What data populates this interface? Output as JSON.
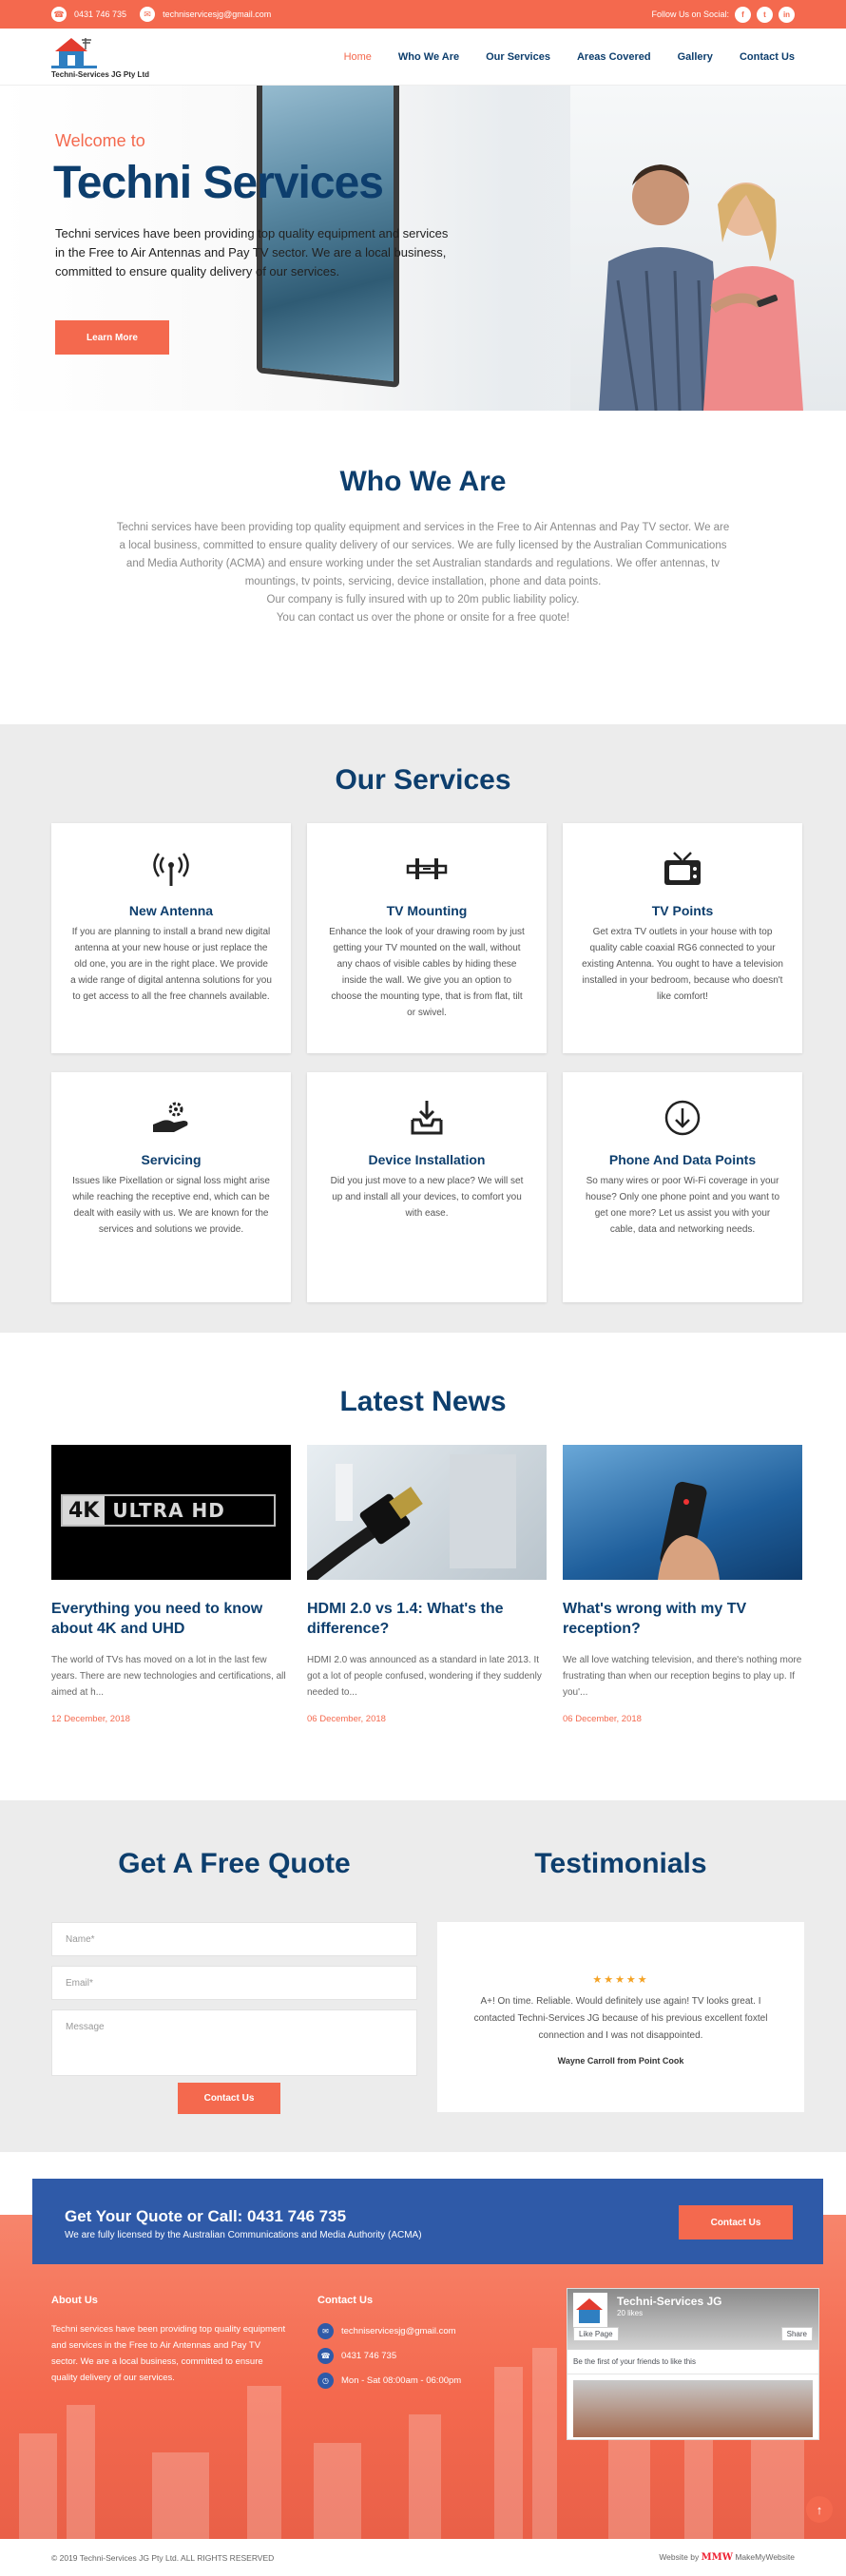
{
  "topbar": {
    "phone": "0431 746 735",
    "email": "techniservicesjg@gmail.com",
    "follow_label": "Follow Us on Social:",
    "social": [
      "f",
      "t",
      "in"
    ]
  },
  "brand": {
    "logo_text": "Techni-Services JG Pty Ltd",
    "accent": "#f4694e",
    "navy": "#0d3e6d",
    "cta_blue": "#2f5aa8"
  },
  "nav": {
    "items": [
      "Home",
      "Who We Are",
      "Our Services",
      "Areas Covered",
      "Gallery",
      "Contact Us"
    ],
    "active": "Home"
  },
  "hero": {
    "welcome": "Welcome to",
    "title": "Techni Services",
    "text": "Techni services have been providing top quality equipment and services in the Free to Air Antennas and Pay TV sector. We are a local business, committed to ensure quality delivery of our services.",
    "button": "Learn More"
  },
  "who": {
    "title": "Who We Are",
    "p1": "Techni services have been providing top quality equipment and services in the Free to Air Antennas and Pay TV sector. We are a local business, committed to ensure quality delivery of our services. We are fully licensed by the Australian Communications and Media Authority (ACMA) and ensure working under the set Australian standards and regulations. We offer antennas, tv mountings, tv points, servicing, device installation, phone and data points.",
    "p2": "Our company is fully insured with up to 20m public liability policy.",
    "p3": "You can contact us over the phone or onsite for a free quote!"
  },
  "services": {
    "title": "Our Services",
    "items": [
      {
        "icon": "antenna-icon",
        "title": "New Antenna",
        "desc": "If you are planning to install a brand new digital antenna at your new house or just replace the old one, you are in the right place. We provide a wide range of digital antenna solutions for you to get access to all the free channels available."
      },
      {
        "icon": "tv-mount-icon",
        "title": "TV Mounting",
        "desc": "Enhance the look of your drawing room by just getting your TV mounted on the wall, without any chaos of visible cables by hiding these inside the wall. We give you an option to choose the mounting type, that is from flat, tilt or swivel."
      },
      {
        "icon": "tv-icon",
        "title": "TV Points",
        "desc": "Get extra TV outlets in your house with top quality cable coaxial RG6 connected to your existing Antenna. You ought to have a television installed in your bedroom, because who doesn't like comfort!"
      },
      {
        "icon": "servicing-icon",
        "title": "Servicing",
        "desc": "Issues like Pixellation or signal loss might arise while reaching the receptive end, which can be dealt with easily with us. We are known for the services and solutions we provide."
      },
      {
        "icon": "device-install-icon",
        "title": "Device Installation",
        "desc": "Did you just move to a new place? We will set up and install all your devices, to comfort you with ease."
      },
      {
        "icon": "download-circle-icon",
        "title": "Phone And Data Points",
        "desc": "So many wires or poor Wi-Fi coverage in your house? Only one phone point and you want to get one more? Let us assist you with your cable, data and networking needs."
      }
    ]
  },
  "news": {
    "title": "Latest News",
    "items": [
      {
        "title": "Everything you need to know about 4K and UHD",
        "excerpt": "The world of TVs has moved on a lot in the last few years. There are new technologies and certifications, all aimed at h...",
        "date": "12 December, 2018",
        "image_text_a": "4K",
        "image_text_b": "ULTRA HD"
      },
      {
        "title": "HDMI 2.0 vs 1.4: What's the difference?",
        "excerpt": "HDMI 2.0 was announced as a standard in late 2013. It got a lot of people confused, wondering if they suddenly needed to...",
        "date": "06 December, 2018"
      },
      {
        "title": "What's wrong with my TV reception?",
        "excerpt": "We all love watching television, and there's nothing more frustrating than when our reception begins to play up. If you'...",
        "date": "06 December, 2018"
      }
    ]
  },
  "quote": {
    "title": "Get A Free Quote",
    "name_placeholder": "Name*",
    "email_placeholder": "Email*",
    "message_placeholder": "Message",
    "button": "Contact Us"
  },
  "testimonials": {
    "title": "Testimonials",
    "rating": 5,
    "stars": "★★★★★",
    "text": "A+! On time. Reliable. Would definitely use again! TV looks great. I contacted Techni-Services JG because of his previous excellent foxtel connection and I was not disappointed.",
    "author": "Wayne Carroll from Point Cook"
  },
  "cta": {
    "title": "Get Your Quote or Call: 0431 746 735",
    "subtitle": "We are fully licensed by the Australian Communications and Media Authority (ACMA)",
    "button": "Contact Us"
  },
  "footer": {
    "about_title": "About Us",
    "about_text": "Techni services have been providing top quality equipment and services in the Free to Air Antennas and Pay TV sector. We are a local business, committed to ensure quality delivery of our services.",
    "contact_title": "Contact Us",
    "email": "techniservicesjg@gmail.com",
    "phone": "0431 746 735",
    "hours": "Mon - Sat 08:00am - 06:00pm",
    "fb_name": "Techni-Services JG",
    "fb_likes": "20 likes",
    "fb_like": "Like Page",
    "fb_share": "Share",
    "fb_first": "Be the first of your friends to like this",
    "copyright": "© 2019 Techni-Services JG Pty Ltd. ALL RIGHTS RESERVED",
    "credit_prefix": "Website by",
    "credit_brand": "MMW",
    "credit_name": "MakeMyWebsite"
  }
}
